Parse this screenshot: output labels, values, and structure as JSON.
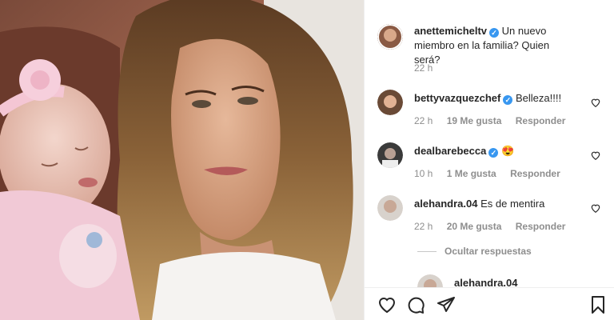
{
  "post": {
    "caption": {
      "username": "anettemicheltv",
      "text": "Un nuevo miembro en la familia? Quien será?",
      "time": "22 h"
    },
    "comments": [
      {
        "username": "bettyvazquezchef",
        "verified": true,
        "text": "Belleza!!!!",
        "time": "22 h",
        "likes": "19 Me gusta",
        "reply": "Responder"
      },
      {
        "username": "dealbarebecca",
        "verified": true,
        "text": "😍",
        "time": "10 h",
        "likes": "1 Me gusta",
        "reply": "Responder"
      },
      {
        "username": "alehandra.04",
        "verified": false,
        "text": "Es de mentira",
        "time": "22 h",
        "likes": "20 Me gusta",
        "reply": "Responder"
      }
    ],
    "hide_replies": "Ocultar respuestas",
    "reply_preview": {
      "username": "alehandra.04"
    }
  },
  "icons": {
    "like": "heart-icon",
    "comment": "comment-icon",
    "share": "paper-plane-icon",
    "save": "bookmark-icon"
  },
  "colors": {
    "verified": "#3897f0",
    "muted": "#8e8e8e",
    "text": "#262626"
  }
}
